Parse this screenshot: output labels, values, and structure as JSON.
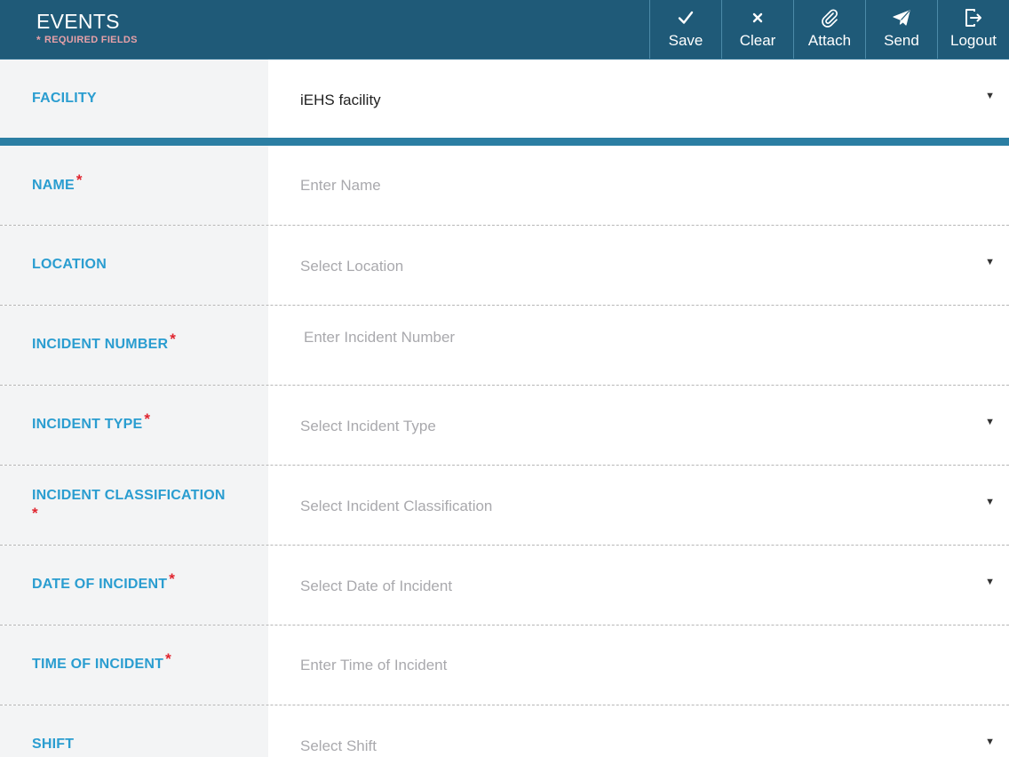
{
  "header": {
    "title": "EVENTS",
    "required_note": "REQUIRED FIELDS",
    "required_star": "*"
  },
  "toolbar": {
    "save_label": "Save",
    "clear_label": "Clear",
    "attach_label": "Attach",
    "send_label": "Send",
    "logout_label": "Logout"
  },
  "form": {
    "facility": {
      "label": "FACILITY",
      "value": "iEHS facility"
    },
    "name": {
      "label": "NAME",
      "placeholder": "Enter Name",
      "required": "*"
    },
    "location": {
      "label": "LOCATION",
      "placeholder": "Select Location"
    },
    "incident_number": {
      "label": "INCIDENT NUMBER",
      "placeholder": "Enter Incident Number",
      "required": "*"
    },
    "incident_type": {
      "label": "INCIDENT TYPE",
      "placeholder": "Select Incident Type",
      "required": "*"
    },
    "incident_classification": {
      "label": "INCIDENT CLASSIFICATION",
      "placeholder": "Select Incident Classification",
      "required": "*"
    },
    "date_of_incident": {
      "label": "DATE OF INCIDENT",
      "placeholder": "Select Date of Incident",
      "required": "*"
    },
    "time_of_incident": {
      "label": "TIME OF INCIDENT",
      "placeholder": "Enter Time of Incident",
      "required": "*"
    },
    "shift": {
      "label": "SHIFT",
      "placeholder": "Select Shift"
    }
  },
  "dropdown_caret": "▼",
  "icons": {
    "save": "check-icon",
    "clear": "close-icon",
    "attach": "paperclip-icon",
    "send": "paper-plane-icon",
    "logout": "logout-icon"
  },
  "colors": {
    "header_bg": "#1f5a78",
    "label_text": "#2a9dd0",
    "required_star": "#e0242e",
    "section_bar": "#2b7ea3"
  }
}
